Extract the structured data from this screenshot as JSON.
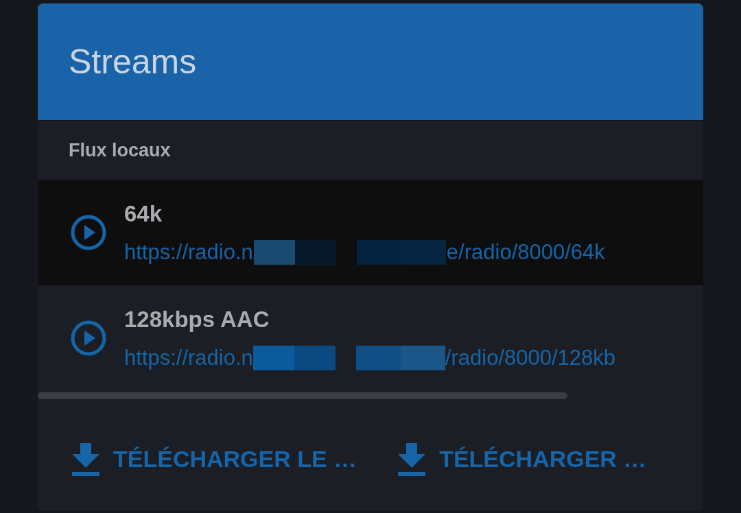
{
  "dialog": {
    "title": "Streams"
  },
  "section": {
    "title": "Flux locaux"
  },
  "streams": [
    {
      "name": "64k",
      "url_start": "https://radio.n",
      "url_end": "e/radio/8000/64k",
      "selected": true
    },
    {
      "name": "128kbps AAC",
      "url_start": "https://radio.n",
      "url_end": "/radio/8000/128kb",
      "selected": false
    }
  ],
  "actions": [
    {
      "label": "TÉLÉCHARGER LE …"
    },
    {
      "label": "TÉLÉCHARGER …"
    }
  ]
}
